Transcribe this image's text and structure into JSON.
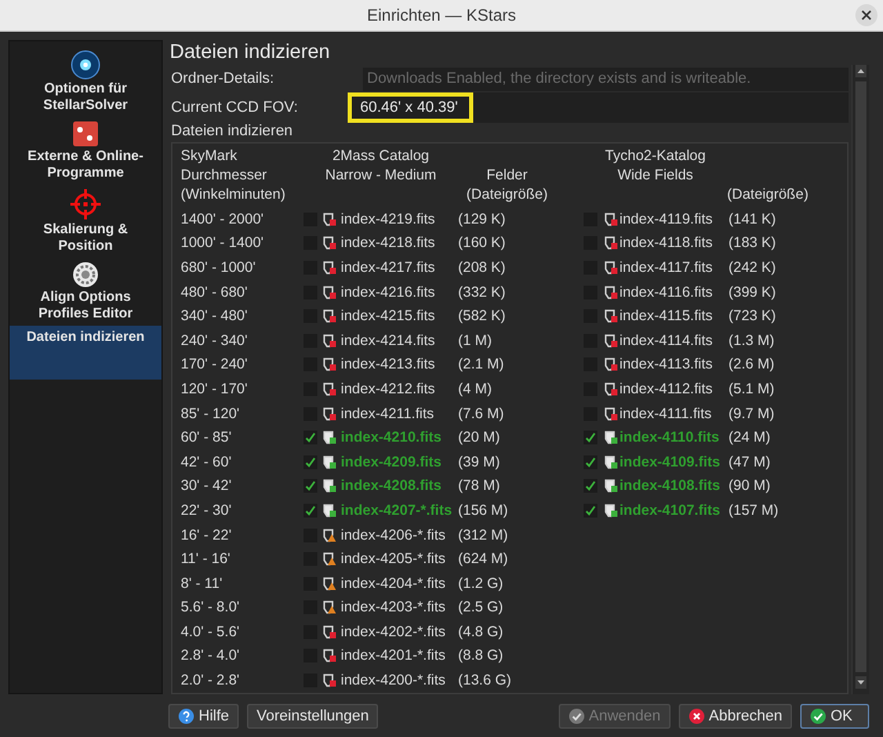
{
  "window": {
    "title": "Einrichten — KStars"
  },
  "sidebar": {
    "items": [
      {
        "label": "Optionen für StellarSolver",
        "kind": "globe",
        "selected": false
      },
      {
        "label": "Externe & Online-Programme",
        "kind": "dice",
        "selected": false
      },
      {
        "label": "Skalierung & Position",
        "kind": "crosshair",
        "selected": false
      },
      {
        "label": "Align Options Profiles Editor",
        "kind": "gear",
        "selected": false
      },
      {
        "label": "Dateien indizieren",
        "kind": "none",
        "selected": true
      }
    ]
  },
  "page": {
    "title": "Dateien indizieren",
    "fields": [
      {
        "label": "Ordner-Details:",
        "value": "Downloads Enabled, the directory exists and is writeable.",
        "disabled": true,
        "highlighted": false
      },
      {
        "label": "Current CCD FOV:",
        "value": "60.46' x 40.39'",
        "disabled": false,
        "highlighted": true
      }
    ],
    "section_label": "Dateien indizieren",
    "index_table": {
      "headers": {
        "skymark": [
          "SkyMark",
          "Durchmesser",
          "(Winkelminuten)"
        ],
        "narrow": [
          "2Mass Catalog",
          "Narrow - Medium"
        ],
        "narrow_size": [
          "Felder",
          "(Dateigröße)"
        ],
        "wide": [
          "Tycho2-Katalog",
          "Wide Fields"
        ],
        "wide_size": [
          "(Dateigröße)"
        ]
      },
      "rows": [
        {
          "range": "1400' - 2000'",
          "narrow": {
            "file": "index-4219.fits",
            "size": "(129 K)",
            "checked": false,
            "installed": false,
            "warning": false
          },
          "wide": {
            "file": "index-4119.fits",
            "size": "(141 K)",
            "checked": false,
            "installed": false,
            "warning": false
          }
        },
        {
          "range": "1000' - 1400'",
          "narrow": {
            "file": "index-4218.fits",
            "size": "(160 K)",
            "checked": false,
            "installed": false,
            "warning": false
          },
          "wide": {
            "file": "index-4118.fits",
            "size": "(183 K)",
            "checked": false,
            "installed": false,
            "warning": false
          }
        },
        {
          "range": "680' - 1000'",
          "narrow": {
            "file": "index-4217.fits",
            "size": "(208 K)",
            "checked": false,
            "installed": false,
            "warning": false
          },
          "wide": {
            "file": "index-4117.fits",
            "size": "(242 K)",
            "checked": false,
            "installed": false,
            "warning": false
          }
        },
        {
          "range": "480' - 680'",
          "narrow": {
            "file": "index-4216.fits",
            "size": "(332 K)",
            "checked": false,
            "installed": false,
            "warning": false
          },
          "wide": {
            "file": "index-4116.fits",
            "size": "(399 K)",
            "checked": false,
            "installed": false,
            "warning": false
          }
        },
        {
          "range": "340' - 480'",
          "narrow": {
            "file": "index-4215.fits",
            "size": "(582 K)",
            "checked": false,
            "installed": false,
            "warning": false
          },
          "wide": {
            "file": "index-4115.fits",
            "size": "(723 K)",
            "checked": false,
            "installed": false,
            "warning": false
          }
        },
        {
          "range": "240' - 340'",
          "narrow": {
            "file": "index-4214.fits",
            "size": "(1 M)",
            "checked": false,
            "installed": false,
            "warning": false
          },
          "wide": {
            "file": "index-4114.fits",
            "size": "(1.3 M)",
            "checked": false,
            "installed": false,
            "warning": false
          }
        },
        {
          "range": "170' - 240'",
          "narrow": {
            "file": "index-4213.fits",
            "size": "(2.1 M)",
            "checked": false,
            "installed": false,
            "warning": false
          },
          "wide": {
            "file": "index-4113.fits",
            "size": "(2.6 M)",
            "checked": false,
            "installed": false,
            "warning": false
          }
        },
        {
          "range": "120' - 170'",
          "narrow": {
            "file": "index-4212.fits",
            "size": "(4 M)",
            "checked": false,
            "installed": false,
            "warning": false
          },
          "wide": {
            "file": "index-4112.fits",
            "size": "(5.1 M)",
            "checked": false,
            "installed": false,
            "warning": false
          }
        },
        {
          "range": "85' - 120'",
          "narrow": {
            "file": "index-4211.fits",
            "size": "(7.6 M)",
            "checked": false,
            "installed": false,
            "warning": false
          },
          "wide": {
            "file": "index-4111.fits",
            "size": "(9.7 M)",
            "checked": false,
            "installed": false,
            "warning": false
          }
        },
        {
          "range": "60' - 85'",
          "narrow": {
            "file": "index-4210.fits",
            "size": "(20 M)",
            "checked": true,
            "installed": true,
            "warning": false
          },
          "wide": {
            "file": "index-4110.fits",
            "size": "(24 M)",
            "checked": true,
            "installed": true,
            "warning": false
          }
        },
        {
          "range": "42' - 60'",
          "narrow": {
            "file": "index-4209.fits",
            "size": "(39 M)",
            "checked": true,
            "installed": true,
            "warning": false
          },
          "wide": {
            "file": "index-4109.fits",
            "size": "(47 M)",
            "checked": true,
            "installed": true,
            "warning": false
          }
        },
        {
          "range": "30' - 42'",
          "narrow": {
            "file": "index-4208.fits",
            "size": "(78 M)",
            "checked": true,
            "installed": true,
            "warning": false
          },
          "wide": {
            "file": "index-4108.fits",
            "size": "(90 M)",
            "checked": true,
            "installed": true,
            "warning": false
          }
        },
        {
          "range": "22' - 30'",
          "narrow": {
            "file": "index-4207-*.fits",
            "size": "(156 M)",
            "checked": true,
            "installed": true,
            "warning": false
          },
          "wide": {
            "file": "index-4107.fits",
            "size": "(157 M)",
            "checked": true,
            "installed": true,
            "warning": false
          }
        },
        {
          "range": "16' - 22'",
          "narrow": {
            "file": "index-4206-*.fits",
            "size": "(312 M)",
            "checked": false,
            "installed": false,
            "warning": true
          }
        },
        {
          "range": "11' - 16'",
          "narrow": {
            "file": "index-4205-*.fits",
            "size": "(624 M)",
            "checked": false,
            "installed": false,
            "warning": true
          }
        },
        {
          "range": "8' - 11'",
          "narrow": {
            "file": "index-4204-*.fits",
            "size": "(1.2 G)",
            "checked": false,
            "installed": false,
            "warning": true
          }
        },
        {
          "range": "5.6' - 8.0'",
          "narrow": {
            "file": "index-4203-*.fits",
            "size": "(2.5 G)",
            "checked": false,
            "installed": false,
            "warning": true
          }
        },
        {
          "range": "4.0' - 5.6'",
          "narrow": {
            "file": "index-4202-*.fits",
            "size": "(4.8 G)",
            "checked": false,
            "installed": false,
            "warning": false
          }
        },
        {
          "range": "2.8' - 4.0'",
          "narrow": {
            "file": "index-4201-*.fits",
            "size": "(8.8 G)",
            "checked": false,
            "installed": false,
            "warning": false
          }
        },
        {
          "range": "2.0' - 2.8'",
          "narrow": {
            "file": "index-4200-*.fits",
            "size": "(13.6 G)",
            "checked": false,
            "installed": false,
            "warning": false
          }
        }
      ]
    }
  },
  "buttons_left": [
    {
      "label": "Hilfe",
      "kind": "help",
      "disabled": false,
      "default": false
    },
    {
      "label": "Voreinstellungen",
      "kind": "plain",
      "disabled": false,
      "default": false
    }
  ],
  "buttons_right": [
    {
      "label": "Anwenden",
      "kind": "apply",
      "disabled": true,
      "default": false
    },
    {
      "label": "Abbrechen",
      "kind": "cancel",
      "disabled": false,
      "default": false
    },
    {
      "label": "OK",
      "kind": "ok",
      "disabled": false,
      "default": true
    }
  ]
}
